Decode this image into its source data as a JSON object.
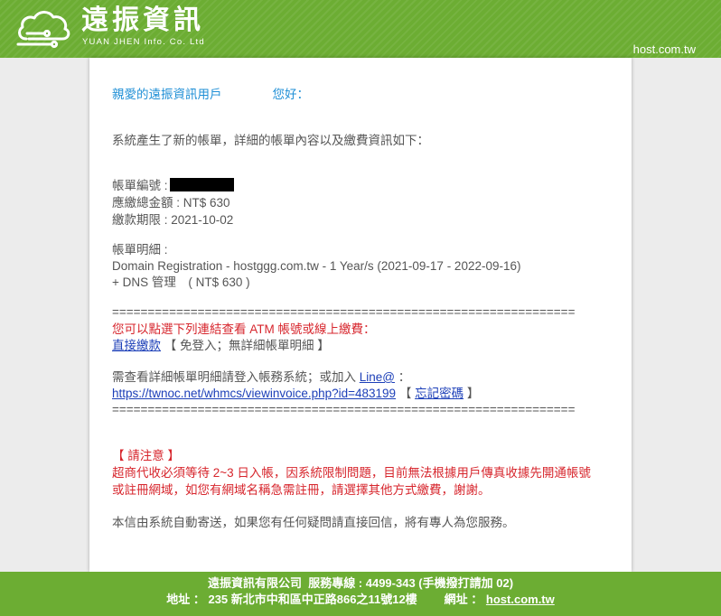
{
  "colors": {
    "brand_green": "#6cad33",
    "greeting_blue": "#1f8fd6",
    "alert_red": "#d7262d",
    "link_blue": "#1c3fb8",
    "body_text": "#555555",
    "page_bg": "#ececec"
  },
  "header": {
    "logo_icon": "cloud-icon",
    "brand_name": "遠振資訊",
    "brand_subtitle": "YUAN JHEN Info. Co. Ltd",
    "site": "host.com.tw"
  },
  "email": {
    "greeting": {
      "salutation": "親愛的遠振資訊用戶",
      "hello": "您好："
    },
    "intro": "系統產生了新的帳單，詳細的帳單內容以及繳費資訊如下：",
    "invoice": {
      "number_label": "帳單編號 :",
      "amount": "應繳總金額 : NT$ 630",
      "due": "繳款期限 : 2021-10-02"
    },
    "details": {
      "label": "帳單明細 :",
      "items": [
        "Domain Registration - hostggg.com.tw - 1 Year/s (2021-09-17 - 2022-09-16)",
        "+ DNS 管理　( NT$ 630 )"
      ]
    },
    "separator": "=================================================================",
    "payment": {
      "notice": "您可以點選下列連結查看 ATM 帳號或線上繳費：",
      "pay_link": "直接繳款",
      "pay_note": " 【 免登入；無詳細帳單明細 】"
    },
    "login": {
      "text": "需查看詳細帳單明細請登入帳務系統；或加入 ",
      "line_link": "Line@",
      "line_suffix": " ：",
      "invoice_url": "https://twnoc.net/whmcs/viewinvoice.php?id=483199",
      "bracket_open": " 【 ",
      "forgot_link": "忘記密碼",
      "bracket_close": " 】"
    },
    "notice": {
      "title": "【 請注意 】",
      "lines": [
        "超商代收必須等待 2~3 日入帳，因系統限制問題，目前無法根據用戶傳真收據先開通帳號",
        "或註冊網域，如您有網域名稱急需註冊，請選擇其他方式繳費，謝謝。"
      ]
    },
    "closing": "本信由系統自動寄送，如果您有任何疑問請直接回信，將有專人為您服務。"
  },
  "footer": {
    "company_line": "遠振資訊有限公司  服務專線 : 4499-343 (手機撥打請加 02)",
    "address": "地址 ： 235 新北市中和區中正路866之11號12樓",
    "web_label": "網址 ： ",
    "web_link": "host.com.tw"
  }
}
